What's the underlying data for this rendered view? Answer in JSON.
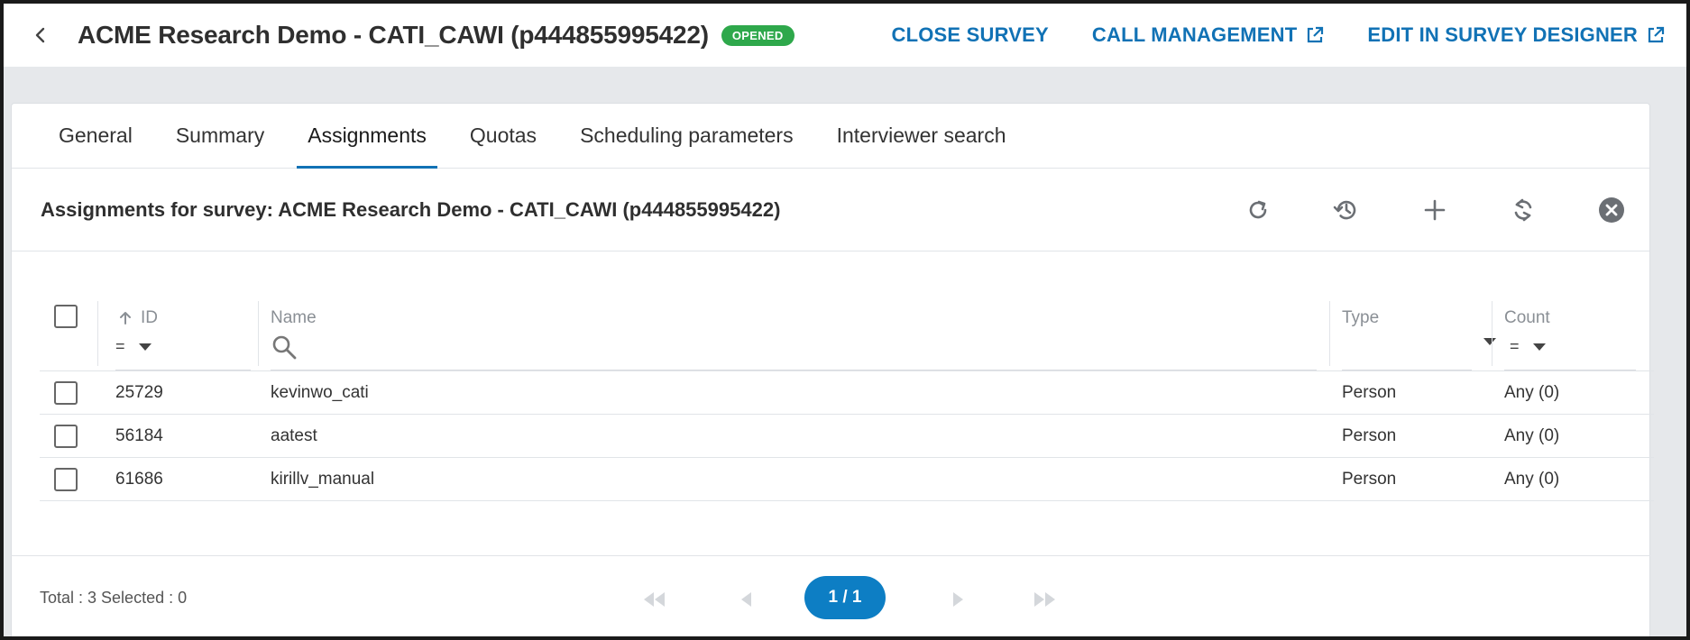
{
  "header": {
    "title": "ACME Research Demo - CATI_CAWI (p444855995422)",
    "status": "OPENED",
    "actions": {
      "close_survey": "CLOSE SURVEY",
      "call_management": "CALL MANAGEMENT",
      "edit_designer": "EDIT IN SURVEY DESIGNER"
    }
  },
  "tabs": [
    {
      "label": "General"
    },
    {
      "label": "Summary"
    },
    {
      "label": "Assignments"
    },
    {
      "label": "Quotas"
    },
    {
      "label": "Scheduling parameters"
    },
    {
      "label": "Interviewer search"
    }
  ],
  "section": {
    "title": "Assignments for survey: ACME Research Demo - CATI_CAWI (p444855995422)"
  },
  "table": {
    "columns": {
      "id": "ID",
      "name": "Name",
      "type": "Type",
      "count": "Count"
    },
    "filters": {
      "id_op": "=",
      "count_op": "="
    },
    "rows": [
      {
        "id": "25729",
        "name": "kevinwo_cati",
        "type": "Person",
        "count": "Any (0)"
      },
      {
        "id": "56184",
        "name": "aatest",
        "type": "Person",
        "count": "Any (0)"
      },
      {
        "id": "61686",
        "name": "kirillv_manual",
        "type": "Person",
        "count": "Any (0)"
      }
    ]
  },
  "footer": {
    "total": "Total : 3 Selected : 0",
    "page": "1 / 1"
  },
  "colors": {
    "accent": "#1172b5",
    "status_green": "#2ea84b",
    "pill_blue": "#0d7ec4"
  }
}
